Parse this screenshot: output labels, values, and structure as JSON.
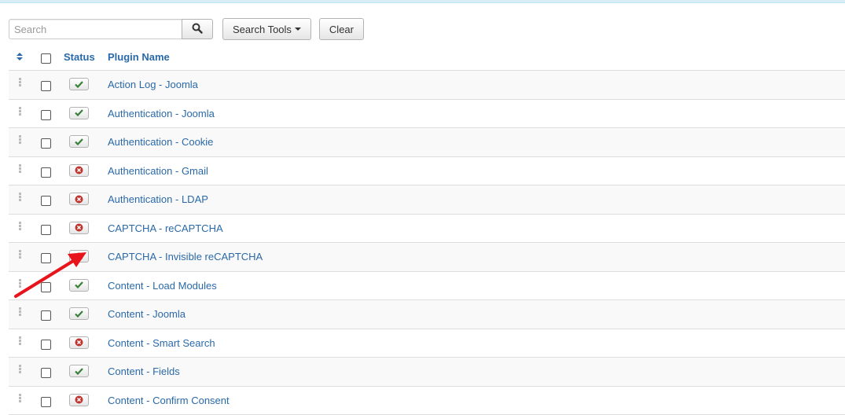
{
  "search": {
    "placeholder": "Search"
  },
  "toolbar": {
    "search_tools_label": "Search Tools",
    "clear_label": "Clear"
  },
  "table": {
    "headers": {
      "status": "Status",
      "name": "Plugin Name"
    },
    "rows": [
      {
        "name": "Action Log - Joomla",
        "enabled": true
      },
      {
        "name": "Authentication - Joomla",
        "enabled": true
      },
      {
        "name": "Authentication - Cookie",
        "enabled": true
      },
      {
        "name": "Authentication - Gmail",
        "enabled": false
      },
      {
        "name": "Authentication - LDAP",
        "enabled": false
      },
      {
        "name": "CAPTCHA - reCAPTCHA",
        "enabled": false
      },
      {
        "name": "CAPTCHA - Invisible reCAPTCHA",
        "enabled": false
      },
      {
        "name": "Content - Load Modules",
        "enabled": true
      },
      {
        "name": "Content - Joomla",
        "enabled": true
      },
      {
        "name": "Content - Smart Search",
        "enabled": false
      },
      {
        "name": "Content - Fields",
        "enabled": true
      },
      {
        "name": "Content - Confirm Consent",
        "enabled": false
      }
    ]
  },
  "colors": {
    "link": "#2a69a8",
    "enabled": "#378137",
    "disabled": "#bd362f",
    "annotation_arrow": "#e8141b"
  },
  "icons": {
    "search": "magnifier-icon",
    "enabled": "checkmark-icon",
    "disabled": "circle-x-icon",
    "sort": "sort-icon",
    "drag": "drag-handle-icon"
  }
}
